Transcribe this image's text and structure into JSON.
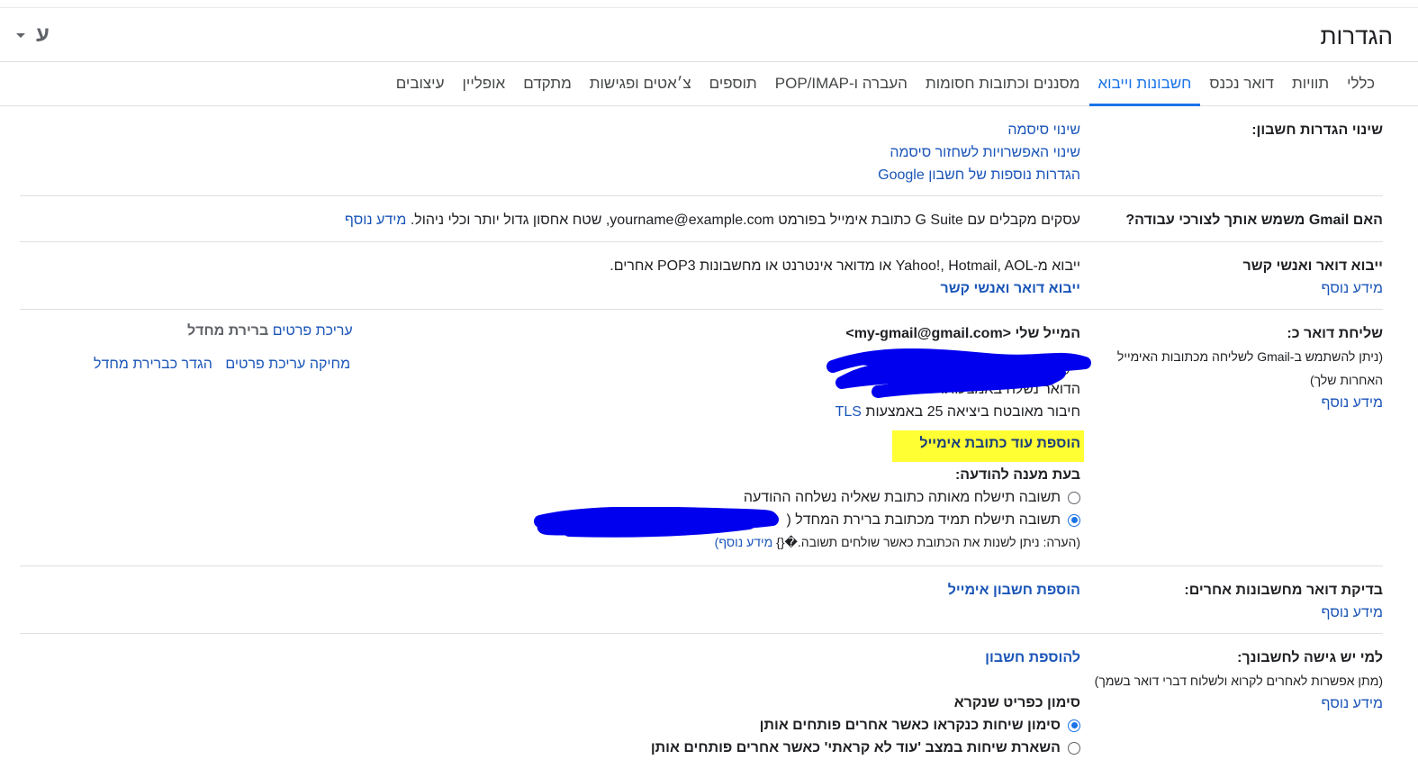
{
  "header": {
    "title": "הגדרות",
    "lang_letter": "ע",
    "lang_caret_icon": "caret-down-icon"
  },
  "tabs": [
    {
      "label": "כללי",
      "active": false
    },
    {
      "label": "תוויות",
      "active": false
    },
    {
      "label": "דואר נכנס",
      "active": false
    },
    {
      "label": "חשבונות וייבוא",
      "active": true
    },
    {
      "label": "מסננים וכתובות חסומות",
      "active": false
    },
    {
      "label": "העברה ו-POP/IMAP",
      "active": false
    },
    {
      "label": "תוספים",
      "active": false
    },
    {
      "label": "צ׳אטים ופגישות",
      "active": false
    },
    {
      "label": "מתקדם",
      "active": false
    },
    {
      "label": "אופליין",
      "active": false
    },
    {
      "label": "עיצובים",
      "active": false
    }
  ],
  "account_settings": {
    "label": "שינוי הגדרות חשבון:",
    "links": [
      "שינוי סיסמה",
      "שינוי האפשרויות לשחזור סיסמה",
      "הגדרות נוספות של חשבון Google"
    ]
  },
  "work_use": {
    "label": "האם Gmail משמש אותך לצורכי עבודה?",
    "text": "עסקים מקבלים עם G Suite כתובת אימייל בפורמט yourname@example.com, שטח אחסון גדול יותר וכלי ניהול.",
    "more": "מידע נוסף"
  },
  "import": {
    "label": "ייבוא דואר ואנשי קשר",
    "more": "מידע נוסף",
    "text": "ייבוא מ-Yahoo!‎, Hotmail, AOL או מדואר אינטרנט או מחשבונות POP3 אחרים.",
    "action": "ייבוא דואר ואנשי קשר"
  },
  "send_as": {
    "label": "שליחת דואר כ:",
    "sub1": "(ניתן להשתמש ב-Gmail לשליחה מכתובות האימייל",
    "sub2": "האחרות שלך)",
    "more": "מידע נוסף",
    "primary": "המייל שלי <my-gmail@gmail.com>",
    "primary_default": "ברירת מחדל",
    "primary_edit": "עריכת פרטים",
    "second_line1": "<my-",
    "second_line2": "הדואר נשלח באמצעות:",
    "second_line3_a": "חיבור מאובטח ביציאה 25 באמצעות",
    "second_line3_b": "TLS",
    "second_make_default": "הגדר כברירת מחדל",
    "second_edit": "עריכת פרטים",
    "second_delete": "מחיקה",
    "add_address": "הוספת עוד כתובת אימייל",
    "reply_heading": "בעת מענה להודעה:",
    "reply_opt1": "תשובה תישלח מאותה כתובת שאליה נשלחה ההודעה",
    "reply_opt2": "תשובה תישלח תמיד מכתובת ברירת המחדל (",
    "note": "(הערה: ניתן לשנות את הכתובת כאשר שולחים תשובה.�{}",
    "note_more": "מידע נוסף)"
  },
  "check_mail": {
    "label": "בדיקת דואר מחשבונות אחרים:",
    "more": "מידע נוסף",
    "action": "הוספת חשבון אימייל"
  },
  "grant_access": {
    "label": "למי יש גישה לחשבונך:",
    "sub": "(מתן אפשרות לאחרים לקרוא ולשלוח דברי דואר בשמך)",
    "more": "מידע נוסף",
    "action": "להוספת חשבון",
    "read_heading": "סימון כפריט שנקרא",
    "opt1": "סימון שיחות כנקראו כאשר אחרים פותחים אותן",
    "opt2": "השארת שיחות במצב 'עוד לא קראתי' כאשר אחרים פותחים אותן"
  },
  "colors": {
    "link": "#1a55b8",
    "accent": "#1a73e8",
    "highlight": "#ffff33",
    "scribble": "#0000ee"
  }
}
